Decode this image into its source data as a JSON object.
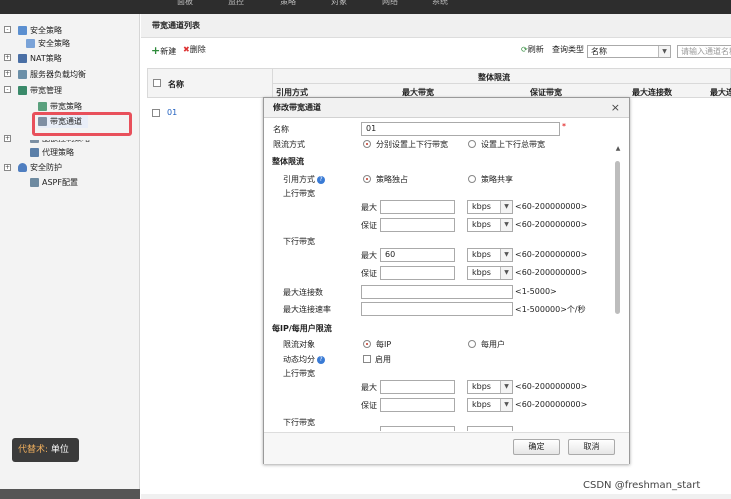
{
  "top_nav": {
    "items": [
      "面板",
      "监控",
      "策略",
      "对象",
      "网络",
      "系统"
    ]
  },
  "tree": {
    "nodes": [
      {
        "label": "安全策略",
        "icon": "policy-icon",
        "toggle": "-"
      },
      {
        "label": "安全策略",
        "icon": "policy-icon"
      },
      {
        "label": "NAT策略",
        "icon": "nat-icon",
        "toggle": "+"
      },
      {
        "label": "服务器负载均衡",
        "icon": "server-icon",
        "toggle": "+"
      },
      {
        "label": "带宽管理",
        "icon": "bandwidth-icon",
        "toggle": "-"
      },
      {
        "label": "带宽策略",
        "icon": "bandwidth-policy-icon"
      },
      {
        "label": "带宽通道",
        "icon": "channel-icon"
      },
      {
        "label": "配额控制策略",
        "icon": "quota-icon",
        "toggle": "+"
      },
      {
        "label": "代理策略",
        "icon": "proxy-icon"
      },
      {
        "label": "安全防护",
        "icon": "shield-icon",
        "toggle": "+"
      },
      {
        "label": "ASPF配置",
        "icon": "aspf-icon"
      }
    ],
    "tooltip_prefix": "代替术:",
    "tooltip_value": "单位"
  },
  "main": {
    "title": "带宽通道列表",
    "toolbar": {
      "new_label": "新建",
      "delete_label": "删除",
      "refresh_label": "刷新",
      "query_type_label": "查询类型",
      "query_type_value": "名称",
      "search_placeholder": "请输入通道名称"
    },
    "table": {
      "name_header": "名称",
      "group_header": "整体限流",
      "columns": [
        "引用方式",
        "最大带宽",
        "保证带宽",
        "最大连接数",
        "最大连"
      ],
      "rows": [
        {
          "name": "01"
        }
      ]
    }
  },
  "dialog": {
    "title": "修改带宽通道",
    "name_label": "名称",
    "name_value": "01",
    "limit_mode_label": "限流方式",
    "limit_mode_options": [
      "分别设置上下行带宽",
      "设置上下行总带宽"
    ],
    "overall_section": "整体限流",
    "ref_mode_label": "引用方式",
    "ref_mode_options": [
      "策略独占",
      "策略共享"
    ],
    "upstream_label": "上行带宽",
    "downstream_label": "下行带宽",
    "max_label": "最大",
    "guarantee_label": "保证",
    "unit": "kbps",
    "range_hint": "<60-200000000>",
    "downstream_max_value": "60",
    "max_conn_label": "最大连接数",
    "max_conn_hint": "<1-5000>",
    "max_conn_rate_label": "最大连接速率",
    "max_conn_rate_hint": "<1-500000>个/秒",
    "per_ip_section": "每IP/每用户限流",
    "limit_object_label": "限流对象",
    "limit_object_options": [
      "每IP",
      "每用户"
    ],
    "dynamic_avg_label": "动态均分",
    "enable_label": "启用",
    "ok_label": "确定",
    "cancel_label": "取消"
  },
  "watermark": "CSDN @freshman_start"
}
